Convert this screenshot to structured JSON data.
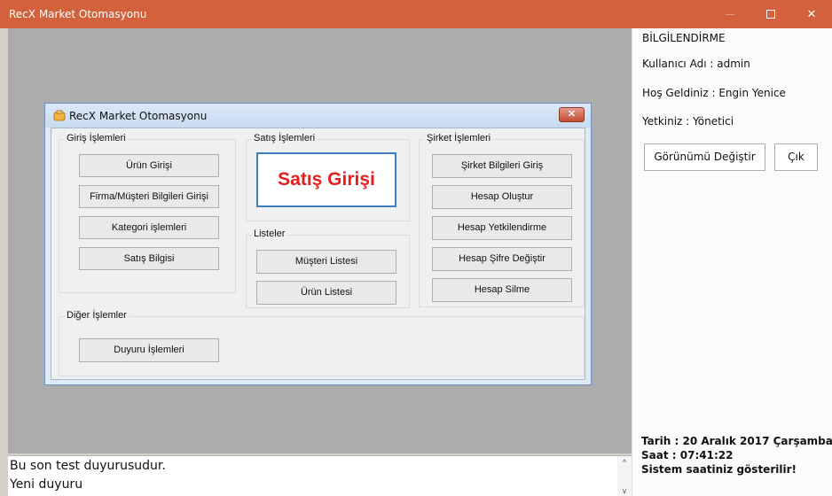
{
  "window": {
    "title": "RecX Market Otomasyonu",
    "min_glyph": "—",
    "close_glyph": "✕"
  },
  "dialog": {
    "title": "RecX Market Otomasyonu",
    "close_glyph": "✕",
    "groups": {
      "giris": {
        "label": "Giriş İşlemleri",
        "buttons": [
          "Ürün Girişi",
          "Firma/Müşteri Bilgileri Girişi",
          "Kategori işlemleri",
          "Satış Bilgisi"
        ]
      },
      "satis": {
        "label": "Satış İşlemleri",
        "big_button": "Satış Girişi"
      },
      "listeler": {
        "label": "Listeler",
        "buttons": [
          "Müşteri Listesi",
          "Ürün Listesi"
        ]
      },
      "sirket": {
        "label": "Şirket İşlemleri",
        "buttons": [
          "Şirket Bilgileri Giriş",
          "Hesap Oluştur",
          "Hesap Yetkilendirme",
          "Hesap Şifre Değiştir",
          "Hesap Silme"
        ]
      },
      "diger": {
        "label": "Diğer İşlemler",
        "buttons": [
          "Duyuru İşlemleri"
        ]
      }
    }
  },
  "info_panel": {
    "heading": "BİLGİLENDİRME",
    "user_label": "Kullanıcı Adı :",
    "user_value": "admin",
    "welcome_label": "Hoş Geldiniz :",
    "welcome_value": "Engin Yenice",
    "role_label": "Yetkiniz :",
    "role_value": "Yönetici",
    "change_view_button": "Görünümü Değiştir",
    "exit_button": "Çık",
    "date_label": "Tarih",
    "date_value": ": 20 Aralık 2017 Çarşamba",
    "time_label": "Saat",
    "time_value": ": 07:41:22",
    "clock_note": "Sistem saatiniz gösterilir!"
  },
  "notice": {
    "lines": [
      "Bu son test duyurusudur.",
      "Yeni duyuru"
    ],
    "scroll_up": "^",
    "scroll_down": "v"
  },
  "colors": {
    "titlebar": "#d2613c",
    "desktop": "#acacac",
    "accent_button_text": "#e81d1d",
    "accent_button_border": "#3d7ebf"
  }
}
